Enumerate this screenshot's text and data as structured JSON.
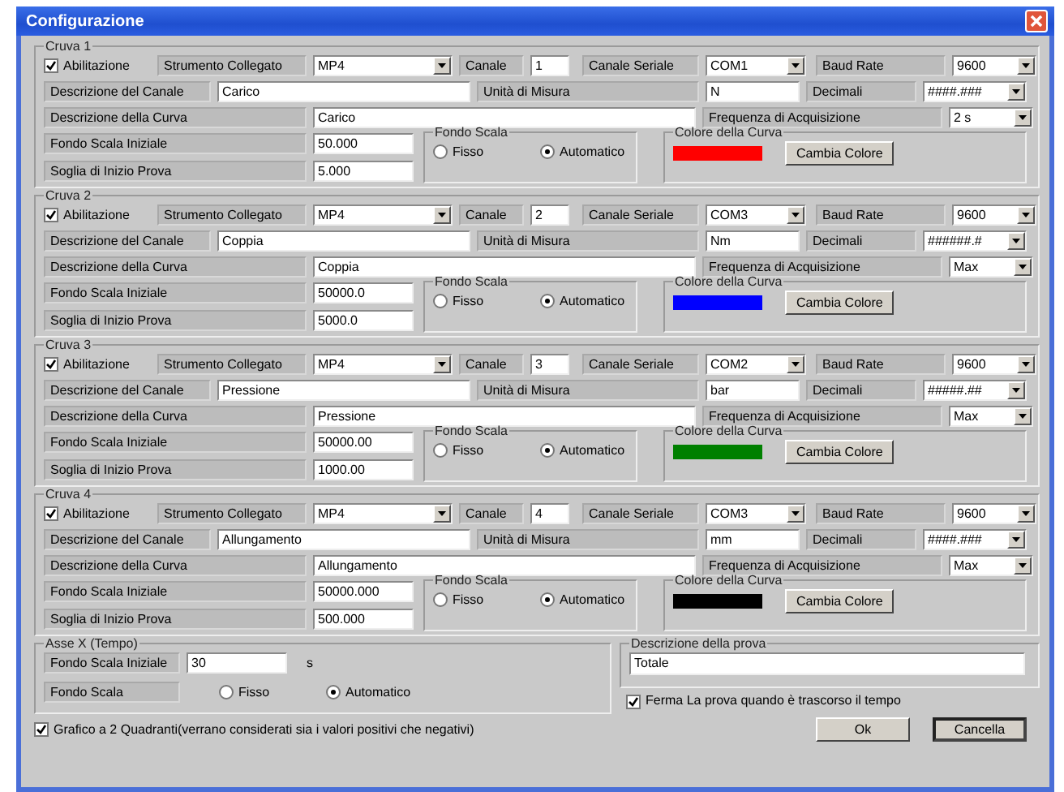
{
  "window": {
    "title": "Configurazione"
  },
  "curves": [
    {
      "title": "Cruva 1",
      "enabled": true,
      "enable_label": "Abilitazione",
      "instrument_label": "Strumento Collegato",
      "instrument": "MP4",
      "channel_label": "Canale",
      "channel": "1",
      "serial_label": "Canale Seriale",
      "serial": "COM1",
      "baud_label": "Baud Rate",
      "baud": "9600",
      "channel_desc_label": "Descrizione del Canale",
      "channel_desc": "Carico",
      "unit_label": "Unità di Misura",
      "unit": "N",
      "decimals_label": "Decimali",
      "decimals": "####.###",
      "curve_desc_label": "Descrizione della Curva",
      "curve_desc": "Carico",
      "freq_label": "Frequenza di Acquisizione",
      "freq": "2 s",
      "fs_label": "Fondo Scala Iniziale",
      "fs": "50.000",
      "threshold_label": "Soglia di Inizio Prova",
      "threshold": "5.000",
      "mode_title": "Fondo Scala",
      "modes": [
        {
          "label": "Fisso",
          "selected": false
        },
        {
          "label": "Automatico",
          "selected": true
        }
      ],
      "color_title": "Colore della Curva",
      "color": "#ff0000",
      "color_button": "Cambia Colore"
    },
    {
      "title": "Cruva 2",
      "enabled": true,
      "enable_label": "Abilitazione",
      "instrument_label": "Strumento Collegato",
      "instrument": "MP4",
      "channel_label": "Canale",
      "channel": "2",
      "serial_label": "Canale Seriale",
      "serial": "COM3",
      "baud_label": "Baud Rate",
      "baud": "9600",
      "channel_desc_label": "Descrizione del Canale",
      "channel_desc": "Coppia",
      "unit_label": "Unità di Misura",
      "unit": "Nm",
      "decimals_label": "Decimali",
      "decimals": "######.#",
      "curve_desc_label": "Descrizione della Curva",
      "curve_desc": "Coppia",
      "freq_label": "Frequenza di Acquisizione",
      "freq": "Max",
      "fs_label": "Fondo Scala Iniziale",
      "fs": "50000.0",
      "threshold_label": "Soglia di Inizio Prova",
      "threshold": "5000.0",
      "mode_title": "Fondo Scala",
      "modes": [
        {
          "label": "Fisso",
          "selected": false
        },
        {
          "label": "Automatico",
          "selected": true
        }
      ],
      "color_title": "Colore della Curva",
      "color": "#0000ff",
      "color_button": "Cambia Colore"
    },
    {
      "title": "Cruva 3",
      "enabled": true,
      "enable_label": "Abilitazione",
      "instrument_label": "Strumento Collegato",
      "instrument": "MP4",
      "channel_label": "Canale",
      "channel": "3",
      "serial_label": "Canale Seriale",
      "serial": "COM2",
      "baud_label": "Baud Rate",
      "baud": "9600",
      "channel_desc_label": "Descrizione del Canale",
      "channel_desc": "Pressione",
      "unit_label": "Unità di Misura",
      "unit": "bar",
      "decimals_label": "Decimali",
      "decimals": "#####.##",
      "curve_desc_label": "Descrizione della Curva",
      "curve_desc": "Pressione",
      "freq_label": "Frequenza di Acquisizione",
      "freq": "Max",
      "fs_label": "Fondo Scala Iniziale",
      "fs": "50000.00",
      "threshold_label": "Soglia di Inizio Prova",
      "threshold": "1000.00",
      "mode_title": "Fondo Scala",
      "modes": [
        {
          "label": "Fisso",
          "selected": false
        },
        {
          "label": "Automatico",
          "selected": true
        }
      ],
      "color_title": "Colore della Curva",
      "color": "#008000",
      "color_button": "Cambia Colore"
    },
    {
      "title": "Cruva 4",
      "enabled": true,
      "enable_label": "Abilitazione",
      "instrument_label": "Strumento Collegato",
      "instrument": "MP4",
      "channel_label": "Canale",
      "channel": "4",
      "serial_label": "Canale Seriale",
      "serial": "COM3",
      "baud_label": "Baud Rate",
      "baud": "9600",
      "channel_desc_label": "Descrizione del Canale",
      "channel_desc": "Allungamento",
      "unit_label": "Unità di Misura",
      "unit": "mm",
      "decimals_label": "Decimali",
      "decimals": "####.###",
      "curve_desc_label": "Descrizione della Curva",
      "curve_desc": "Allungamento",
      "freq_label": "Frequenza di Acquisizione",
      "freq": "Max",
      "fs_label": "Fondo Scala Iniziale",
      "fs": "50000.000",
      "threshold_label": "Soglia di Inizio Prova",
      "threshold": "500.000",
      "mode_title": "Fondo Scala",
      "modes": [
        {
          "label": "Fisso",
          "selected": false
        },
        {
          "label": "Automatico",
          "selected": true
        }
      ],
      "color_title": "Colore della Curva",
      "color": "#000000",
      "color_button": "Cambia Colore"
    }
  ],
  "axis": {
    "title": "Asse X (Tempo)",
    "fs_label": "Fondo Scala Iniziale",
    "fs": "30",
    "unit": "s",
    "mode_label": "Fondo Scala",
    "modes": [
      {
        "label": "Fisso",
        "selected": false
      },
      {
        "label": "Automatico",
        "selected": true
      }
    ]
  },
  "test": {
    "title": "Descrizione della prova",
    "value": "Totale",
    "stop_label": "Ferma La prova quando è trascorso il tempo",
    "stop_checked": true
  },
  "quadrants": {
    "label": "Grafico a 2 Quadranti(verrano considerati sia i valori positivi che negativi)",
    "checked": true
  },
  "buttons": [
    {
      "label": "Ok",
      "default": false
    },
    {
      "label": "Cancella",
      "default": true
    }
  ]
}
